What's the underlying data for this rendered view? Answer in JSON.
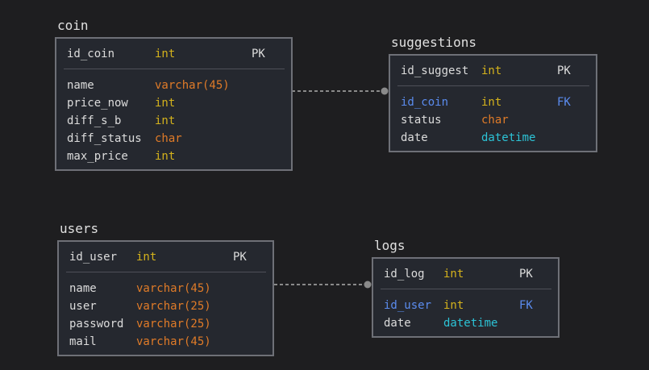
{
  "tables": {
    "coin": {
      "title": "coin",
      "pk": {
        "field": "id_coin",
        "type": "int",
        "key": "PK"
      },
      "rows": [
        {
          "field": "name",
          "type": "varchar(45)"
        },
        {
          "field": "price_now",
          "type": "int"
        },
        {
          "field": "diff_s_b",
          "type": "int"
        },
        {
          "field": "diff_status",
          "type": "char"
        },
        {
          "field": "max_price",
          "type": "int"
        }
      ]
    },
    "suggestions": {
      "title": "suggestions",
      "pk": {
        "field": "id_suggest",
        "type": "int",
        "key": "PK"
      },
      "rows": [
        {
          "field": "id_coin",
          "type": "int",
          "key": "FK"
        },
        {
          "field": "status",
          "type": "char"
        },
        {
          "field": "date",
          "type": "datetime"
        }
      ]
    },
    "users": {
      "title": "users",
      "pk": {
        "field": "id_user",
        "type": "int",
        "key": "PK"
      },
      "rows": [
        {
          "field": "name",
          "type": "varchar(45)"
        },
        {
          "field": "user",
          "type": "varchar(25)"
        },
        {
          "field": "password",
          "type": "varchar(25)"
        },
        {
          "field": "mail",
          "type": "varchar(45)"
        }
      ]
    },
    "logs": {
      "title": "logs",
      "pk": {
        "field": "id_log",
        "type": "int",
        "key": "PK"
      },
      "rows": [
        {
          "field": "id_user",
          "type": "int",
          "key": "FK"
        },
        {
          "field": "date",
          "type": "datetime"
        }
      ]
    }
  },
  "relationships": [
    {
      "from": "coin",
      "to": "suggestions"
    },
    {
      "from": "users",
      "to": "logs"
    }
  ],
  "colors": {
    "background": "#1e1e20",
    "box": "#25282f",
    "border": "#6e7077",
    "int": "#d4b21c",
    "varchar": "#e07b28",
    "datetime": "#2cc3d6",
    "fk": "#5b8cef",
    "connector": "#8a8a8a"
  }
}
